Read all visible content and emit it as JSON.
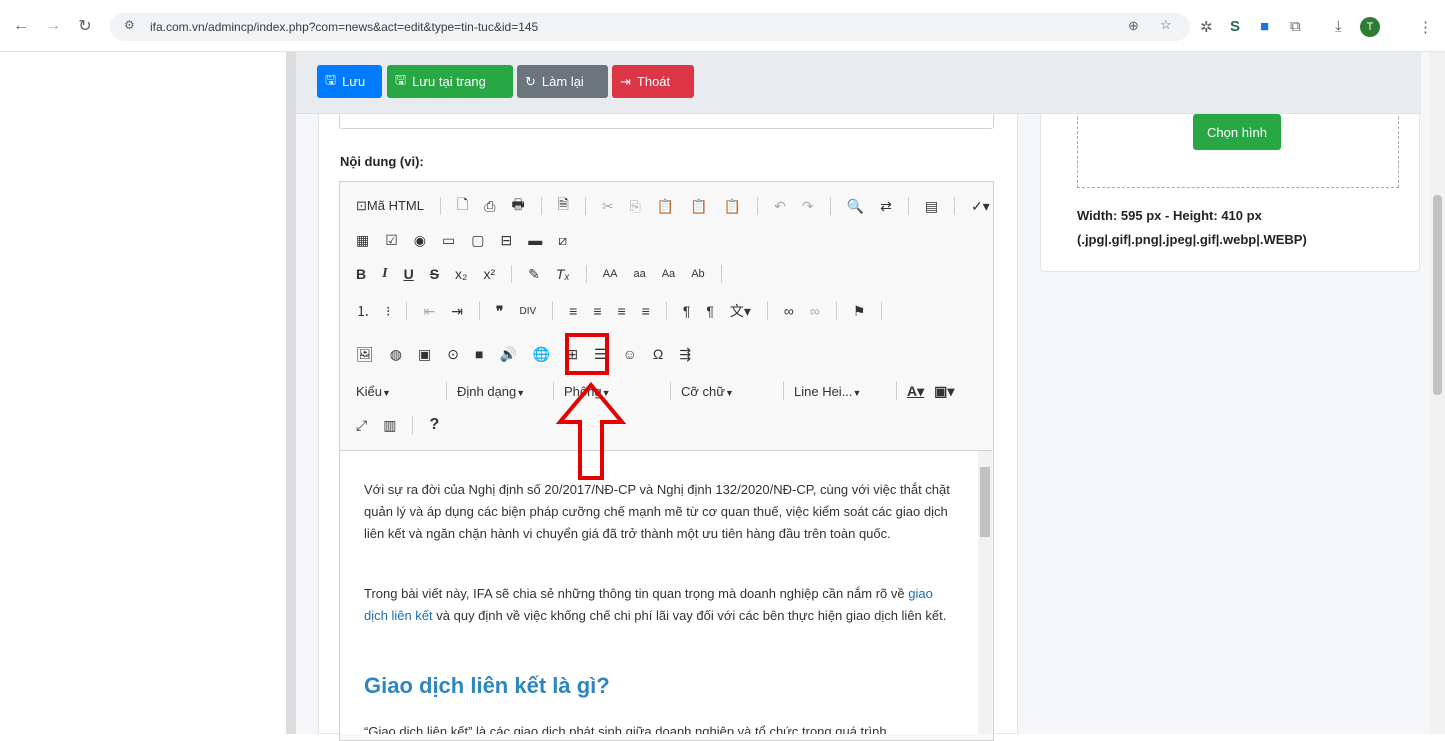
{
  "browser": {
    "url": "ifa.com.vn/admincp/index.php?com=news&act=edit&type=tin-tuc&id=145",
    "profile": "T"
  },
  "toolbar": {
    "save": "Lưu",
    "save_stay": "Lưu tại trang",
    "reset": "Làm lại",
    "exit": "Thoát"
  },
  "section": {
    "title": "Nội dung (vi):"
  },
  "editor": {
    "source": "Mã HTML",
    "style": "Kiểu",
    "format": "Định dạng",
    "font": "Phông",
    "size": "Cỡ chữ",
    "lineheight": "Line Hei...",
    "help": "?"
  },
  "content": {
    "p1": "Với sự ra đời của Nghị định số 20/2017/NĐ-CP và Nghị định 132/2020/NĐ-CP, cùng với việc thắt chặt quản lý và áp dụng các biện pháp cưỡng chế mạnh mẽ từ cơ quan thuế, việc kiểm soát các giao dịch liên kết và ngăn chặn hành vi chuyển giá đã trở thành một ưu tiên hàng đầu trên toàn quốc.",
    "p2a": "Trong bài viết này, IFA sẽ chia sẻ những thông tin quan trọng mà doanh nghiệp cần nắm rõ về ",
    "p2link": "giao dịch liên kết",
    "p2b": " và quy định về việc khống chế chi phí lãi vay đối với các bên thực hiện giao dịch liên kết.",
    "h2": "Giao dịch liên kết là gì?",
    "p3": "“Giao dịch liên kết” là các giao dịch phát sinh giữa doanh nghiệp và tổ chức trong quá trình"
  },
  "image_panel": {
    "choose": "Chọn hình",
    "size": "Width: 595 px - Height: 410 px",
    "types": "(.jpg|.gif|.png|.jpeg|.gif|.webp|.WEBP)"
  },
  "colors": {
    "primary": "#007bff",
    "success": "#28a745",
    "secondary": "#6c757d",
    "danger": "#dc3545",
    "highlight": "#e60000",
    "heading": "#2e86c1"
  }
}
